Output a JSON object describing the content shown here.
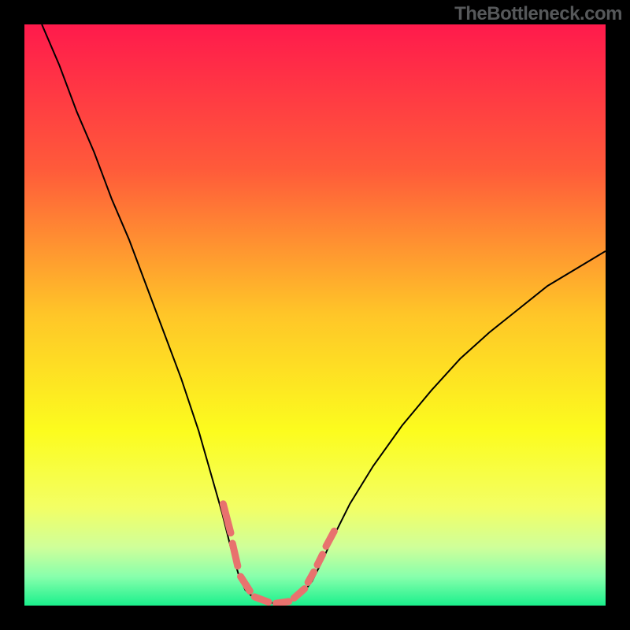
{
  "watermark": "TheBottleneck.com",
  "chart_data": {
    "type": "line",
    "title": "",
    "xlabel": "",
    "ylabel": "",
    "xlim": [
      0,
      100
    ],
    "ylim": [
      0,
      100
    ],
    "gradient": {
      "type": "vertical",
      "stops": [
        {
          "pos": 0.0,
          "color": "#FF1A4C"
        },
        {
          "pos": 0.25,
          "color": "#FF5B3A"
        },
        {
          "pos": 0.5,
          "color": "#FFC628"
        },
        {
          "pos": 0.7,
          "color": "#FCFC1E"
        },
        {
          "pos": 0.83,
          "color": "#F3FF64"
        },
        {
          "pos": 0.9,
          "color": "#CFFF9A"
        },
        {
          "pos": 0.95,
          "color": "#88FFAC"
        },
        {
          "pos": 1.0,
          "color": "#1AF08C"
        }
      ]
    },
    "series": [
      {
        "name": "main-curve",
        "color": "#000000",
        "width": 2,
        "points": [
          [
            3,
            100
          ],
          [
            6,
            93
          ],
          [
            9,
            85
          ],
          [
            12,
            78
          ],
          [
            15,
            70
          ],
          [
            18,
            63
          ],
          [
            21,
            55
          ],
          [
            24,
            47
          ],
          [
            27,
            39
          ],
          [
            30,
            30
          ],
          [
            32,
            23
          ],
          [
            34,
            16
          ],
          [
            35.5,
            10
          ],
          [
            36.8,
            5.5
          ],
          [
            38,
            2.7
          ],
          [
            39.5,
            1.3
          ],
          [
            41,
            0.7
          ],
          [
            43,
            0.4
          ],
          [
            45,
            0.6
          ],
          [
            46.5,
            1.1
          ],
          [
            48,
            2.3
          ],
          [
            49.5,
            4.2
          ],
          [
            51,
            7.2
          ],
          [
            53,
            11.5
          ],
          [
            56,
            17.5
          ],
          [
            60,
            24
          ],
          [
            65,
            31
          ],
          [
            70,
            37
          ],
          [
            75,
            42.5
          ],
          [
            80,
            47
          ],
          [
            85,
            51
          ],
          [
            90,
            55
          ],
          [
            95,
            58
          ],
          [
            100,
            61
          ]
        ]
      },
      {
        "name": "highlight-dashes",
        "color": "#E8726E",
        "width": 9,
        "linecap": "round",
        "segments": [
          [
            [
              34.2,
              17.5
            ],
            [
              35.5,
              12.5
            ]
          ],
          [
            [
              35.8,
              10.7
            ],
            [
              36.7,
              6.8
            ]
          ],
          [
            [
              37.2,
              5.0
            ],
            [
              38.8,
              2.5
            ]
          ],
          [
            [
              39.6,
              1.5
            ],
            [
              42.0,
              0.6
            ]
          ],
          [
            [
              43.3,
              0.4
            ],
            [
              45.5,
              0.7
            ]
          ],
          [
            [
              46.4,
              1.3
            ],
            [
              48.2,
              2.9
            ]
          ],
          [
            [
              48.8,
              4.0
            ],
            [
              49.8,
              5.8
            ]
          ],
          [
            [
              50.4,
              7.0
            ],
            [
              51.3,
              8.8
            ]
          ],
          [
            [
              51.9,
              10.2
            ],
            [
              53.3,
              12.8
            ]
          ]
        ]
      }
    ]
  }
}
